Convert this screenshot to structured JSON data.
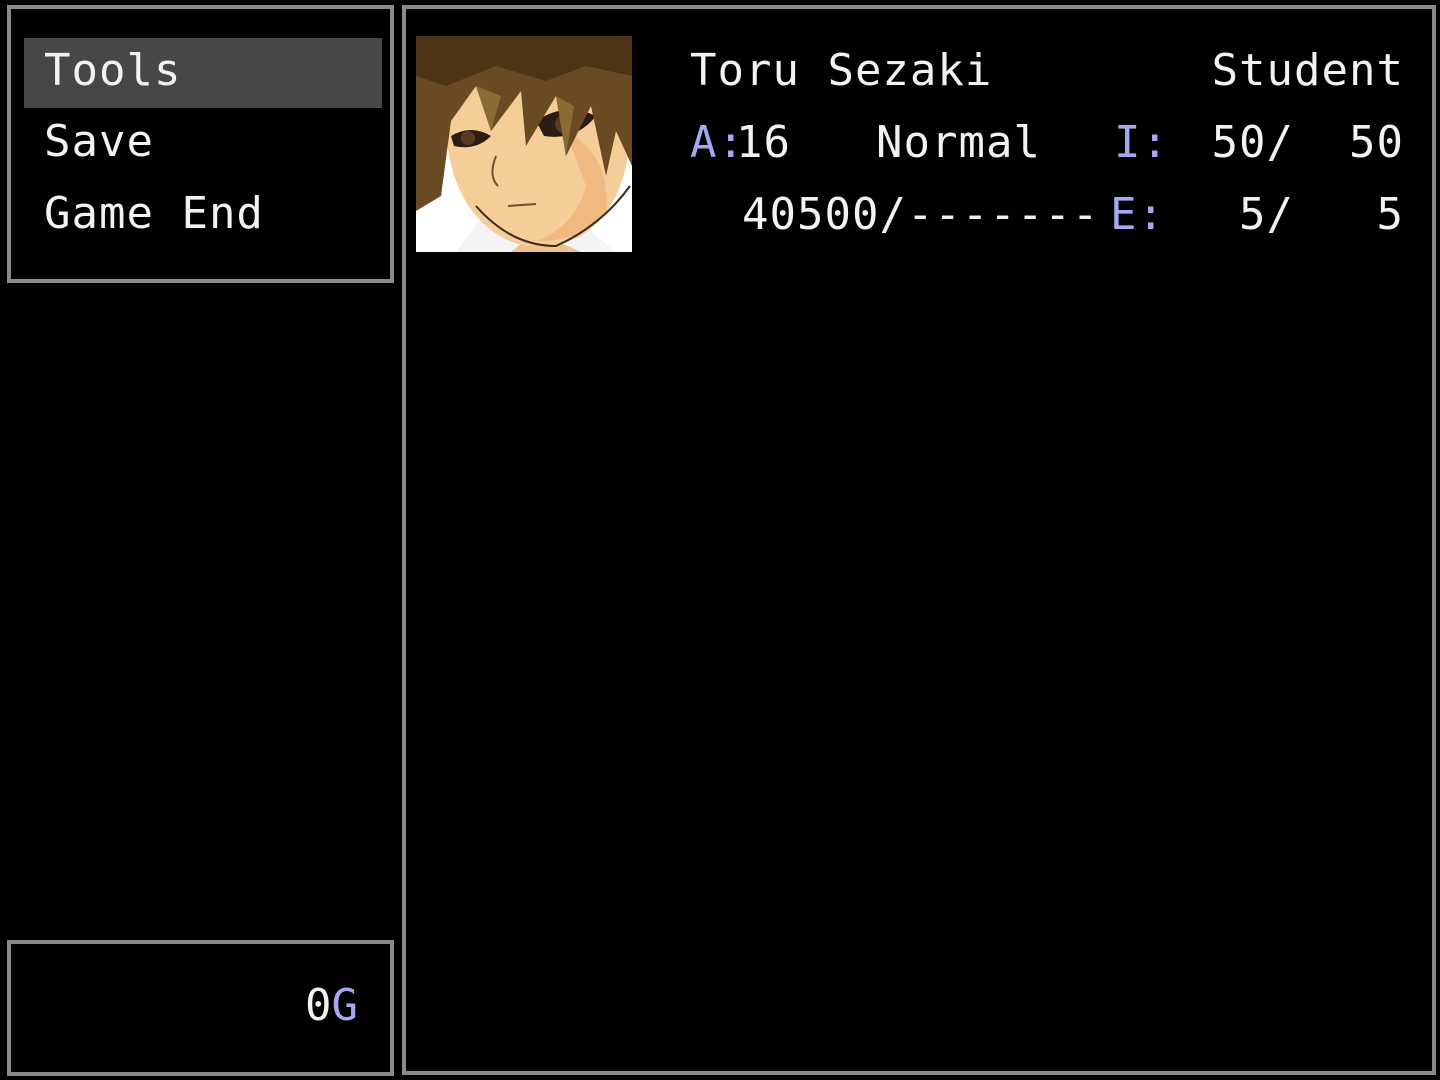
{
  "menu": {
    "items": [
      {
        "label": "Tools",
        "selected": true
      },
      {
        "label": "Save",
        "selected": false
      },
      {
        "label": "Game End",
        "selected": false
      }
    ]
  },
  "gold": {
    "amount": "0",
    "unit": "G"
  },
  "actor": {
    "name": "Toru Sezaki",
    "class": "Student",
    "level_label": "A:",
    "level": "16",
    "state": "Normal",
    "hp_label": "I:",
    "hp": "50/  50",
    "exp": "40500/-------",
    "sp_label": "E:",
    "sp": "5/   5"
  },
  "colors": {
    "window_border": "#8a8a8a",
    "background": "#000000",
    "text": "#f2f2f2",
    "system_label": "#a7a7f0",
    "cursor_highlight": "#474747"
  }
}
